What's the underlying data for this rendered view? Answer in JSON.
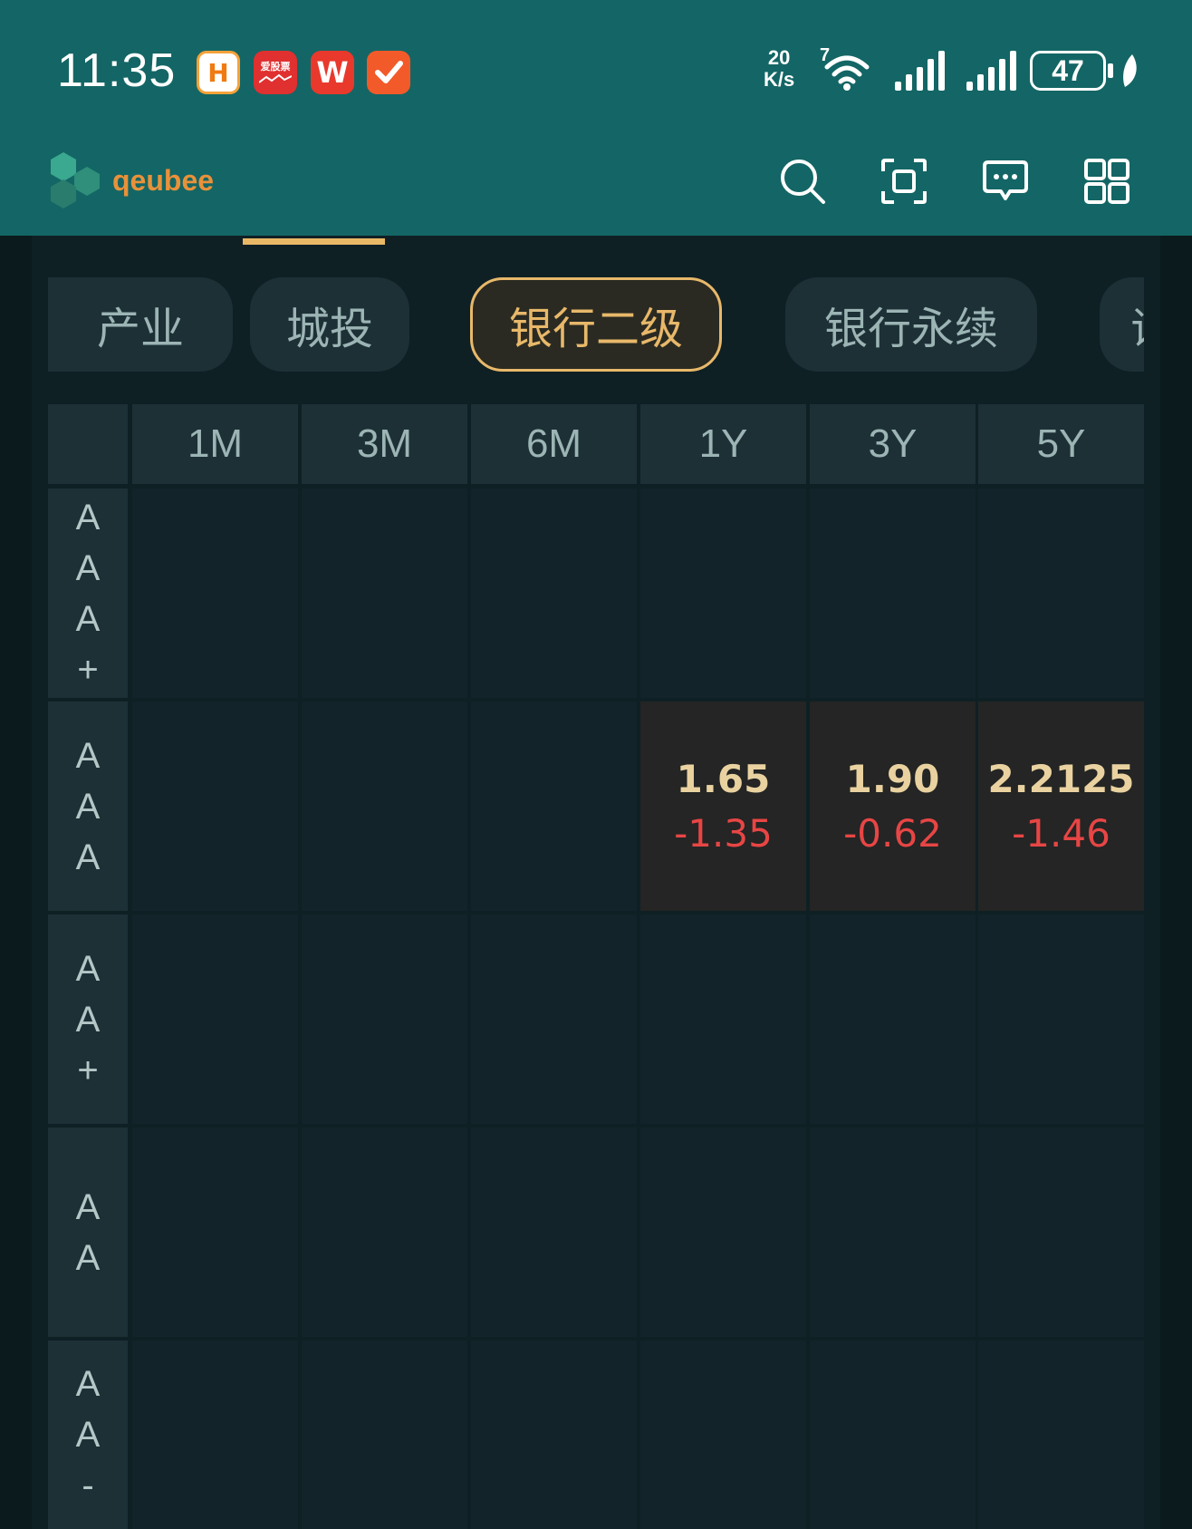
{
  "status_bar": {
    "time": "11:35",
    "net_speed_value": "20",
    "net_speed_unit": "K/s",
    "battery": "47",
    "wifi_badge": "7",
    "app_icons": [
      "app-icon-1",
      "aigupiao-icon",
      "wps-icon",
      "task-icon"
    ],
    "app_icon2_text": "爱股票",
    "app_icon3_text": "W",
    "app_icon1_text": "H"
  },
  "header": {
    "brand": "qeubee",
    "actions": [
      "search-icon",
      "scan-icon",
      "message-icon",
      "grid-menu-icon"
    ]
  },
  "category_tabs": [
    {
      "label": "产业",
      "active": false
    },
    {
      "label": "城投",
      "active": false
    },
    {
      "label": "银行二级",
      "active": true
    },
    {
      "label": "银行永续",
      "active": false
    },
    {
      "label": "证",
      "active": false
    }
  ],
  "grid": {
    "columns": [
      "1M",
      "3M",
      "6M",
      "1Y",
      "3Y",
      "5Y"
    ],
    "rows": [
      {
        "label": [
          "A",
          "A",
          "A",
          "+"
        ],
        "cells": [
          null,
          null,
          null,
          null,
          null,
          null
        ]
      },
      {
        "label": [
          "A",
          "A",
          "A"
        ],
        "cells": [
          null,
          null,
          null,
          {
            "value": "1.65",
            "change": "-1.35"
          },
          {
            "value": "1.90",
            "change": "-0.62"
          },
          {
            "value": "2.2125",
            "change": "-1.46"
          }
        ]
      },
      {
        "label": [
          "A",
          "A",
          "+"
        ],
        "cells": [
          null,
          null,
          null,
          null,
          null,
          null
        ]
      },
      {
        "label": [
          "A",
          "A"
        ],
        "cells": [
          null,
          null,
          null,
          null,
          null,
          null
        ]
      },
      {
        "label": [
          "A",
          "A",
          "-"
        ],
        "cells": [
          null,
          null,
          null,
          null,
          null,
          null
        ]
      }
    ]
  },
  "colors": {
    "header_bg": "#136665",
    "accent": "#e8b86a",
    "negative": "#e84545",
    "value": "#e9d2a0"
  }
}
